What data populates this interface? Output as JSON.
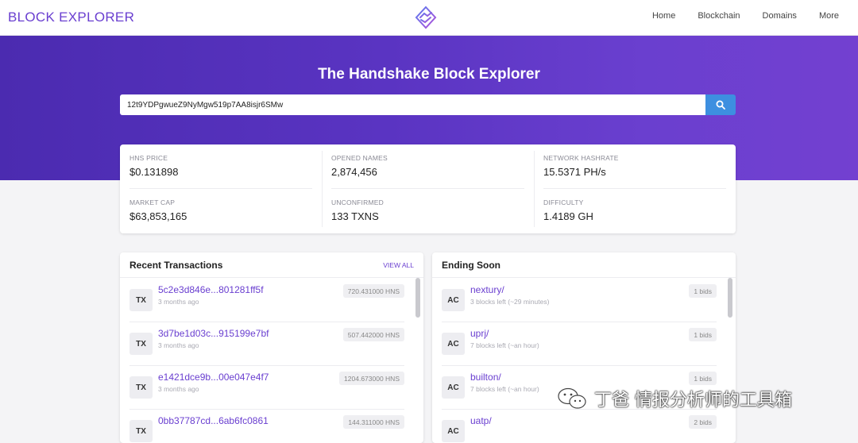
{
  "header": {
    "brand": "BLOCK EXPLORER",
    "logo_icon": "handshake-icon",
    "nav": [
      "Home",
      "Blockchain",
      "Domains",
      "More"
    ]
  },
  "hero": {
    "title": "The Handshake Block Explorer",
    "search_value": "12t9YDPgwueZ9NyMgw519p7AA8isjr6SMw",
    "search_icon": "search-icon"
  },
  "stats": {
    "hns_price": {
      "label": "HNS PRICE",
      "value": "$0.131898"
    },
    "opened_names": {
      "label": "OPENED NAMES",
      "value": "2,874,456"
    },
    "network_hashrate": {
      "label": "NETWORK HASHRATE",
      "value": "15.5371 PH/s"
    },
    "market_cap": {
      "label": "MARKET CAP",
      "value": "$63,853,165"
    },
    "unconfirmed": {
      "label": "UNCONFIRMED",
      "value": "133 TXNS"
    },
    "difficulty": {
      "label": "DIFFICULTY",
      "value": "1.4189 GH"
    }
  },
  "recent": {
    "title": "Recent Transactions",
    "view_all": "VIEW ALL",
    "items": [
      {
        "badge": "TX",
        "hash": "5c2e3d846e...801281ff5f",
        "time": "3 months ago",
        "amount": "720.431000 HNS"
      },
      {
        "badge": "TX",
        "hash": "3d7be1d03c...915199e7bf",
        "time": "3 months ago",
        "amount": "507.442000 HNS"
      },
      {
        "badge": "TX",
        "hash": "e1421dce9b...00e047e4f7",
        "time": "3 months ago",
        "amount": "1204.673000 HNS"
      },
      {
        "badge": "TX",
        "hash": "0bb37787cd...6ab6fc0861",
        "time": "",
        "amount": "144.311000 HNS"
      }
    ]
  },
  "ending": {
    "title": "Ending Soon",
    "items": [
      {
        "badge": "AC",
        "name": "nextury/",
        "left": "3 blocks left (~29 minutes)",
        "bids": "1 bids"
      },
      {
        "badge": "AC",
        "name": "uprj/",
        "left": "7 blocks left (~an hour)",
        "bids": "1 bids"
      },
      {
        "badge": "AC",
        "name": "builton/",
        "left": "7 blocks left (~an hour)",
        "bids": "1 bids"
      },
      {
        "badge": "AC",
        "name": "uatp/",
        "left": "",
        "bids": "2 bids"
      }
    ]
  },
  "watermark": {
    "text": "丁爸 情报分析师的工具箱",
    "icon": "wechat-icon"
  },
  "colors": {
    "accent": "#6a3fd0",
    "hero_start": "#4b2bb0",
    "hero_end": "#7340d0",
    "search_button": "#3d8fe0"
  }
}
